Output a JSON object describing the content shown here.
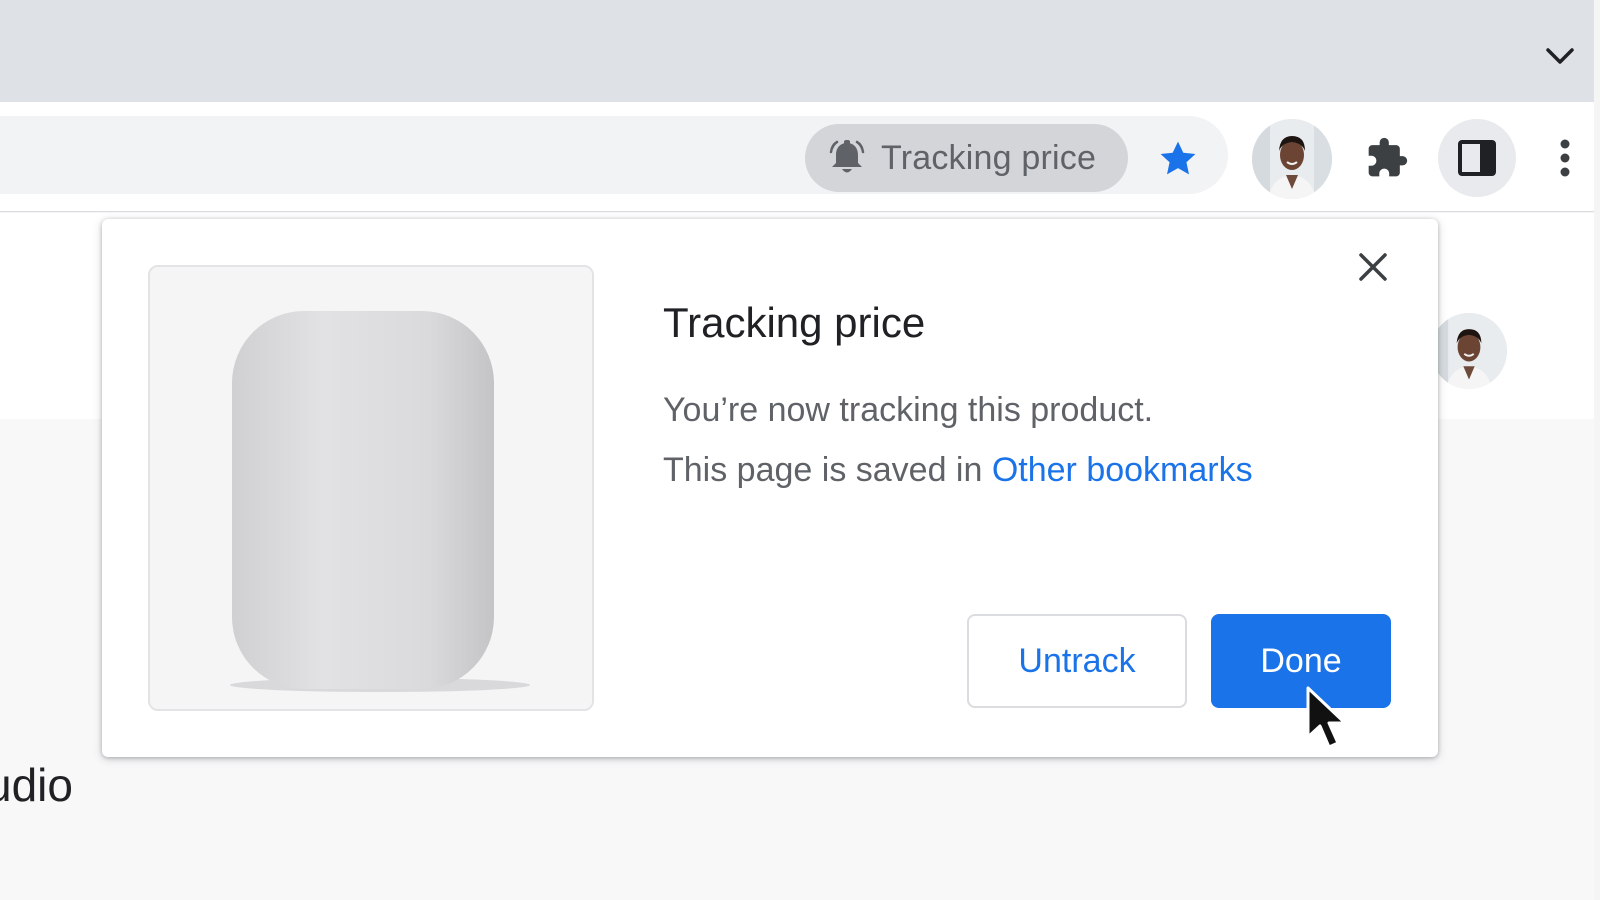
{
  "browser": {
    "toolbar": {
      "price_chip_label": "Tracking price"
    }
  },
  "page": {
    "heading_fragment": "udio"
  },
  "bubble": {
    "title": "Tracking price",
    "description": "You’re now tracking this product.",
    "saved_prefix": "This page is saved in ",
    "saved_link": "Other bookmarks",
    "untrack_label": "Untrack",
    "done_label": "Done"
  },
  "colors": {
    "accent": "#1a73e8",
    "tabstrip": "#dee1e6",
    "chip": "#d3d5d9",
    "secondary_text": "#5f6368"
  },
  "icons": {
    "tabstrip": "chevron-down-icon",
    "chip": "bell-icon",
    "bookmark": "star-icon",
    "extensions": "puzzle-icon",
    "side_panel": "side-panel-icon",
    "menu": "more-vert-icon",
    "close": "close-icon",
    "pointer": "cursor-icon"
  }
}
